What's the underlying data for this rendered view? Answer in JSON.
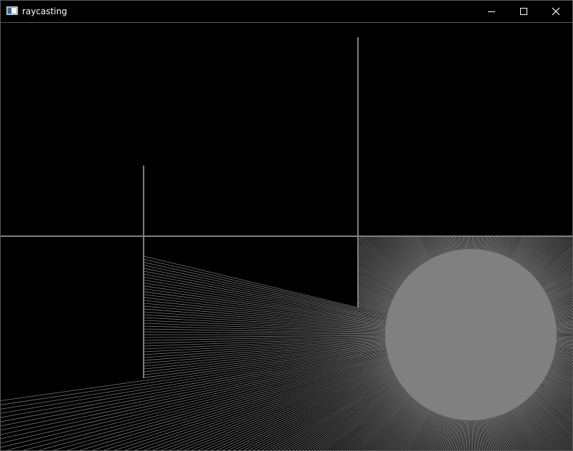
{
  "window": {
    "title": "raycasting"
  },
  "icons": {
    "app": "app-icon",
    "minimize": "minimize-icon",
    "maximize": "maximize-icon",
    "close": "close-icon"
  },
  "scene": {
    "background": "#000000",
    "line_color": "#808080",
    "light_color": "#808080"
  }
}
